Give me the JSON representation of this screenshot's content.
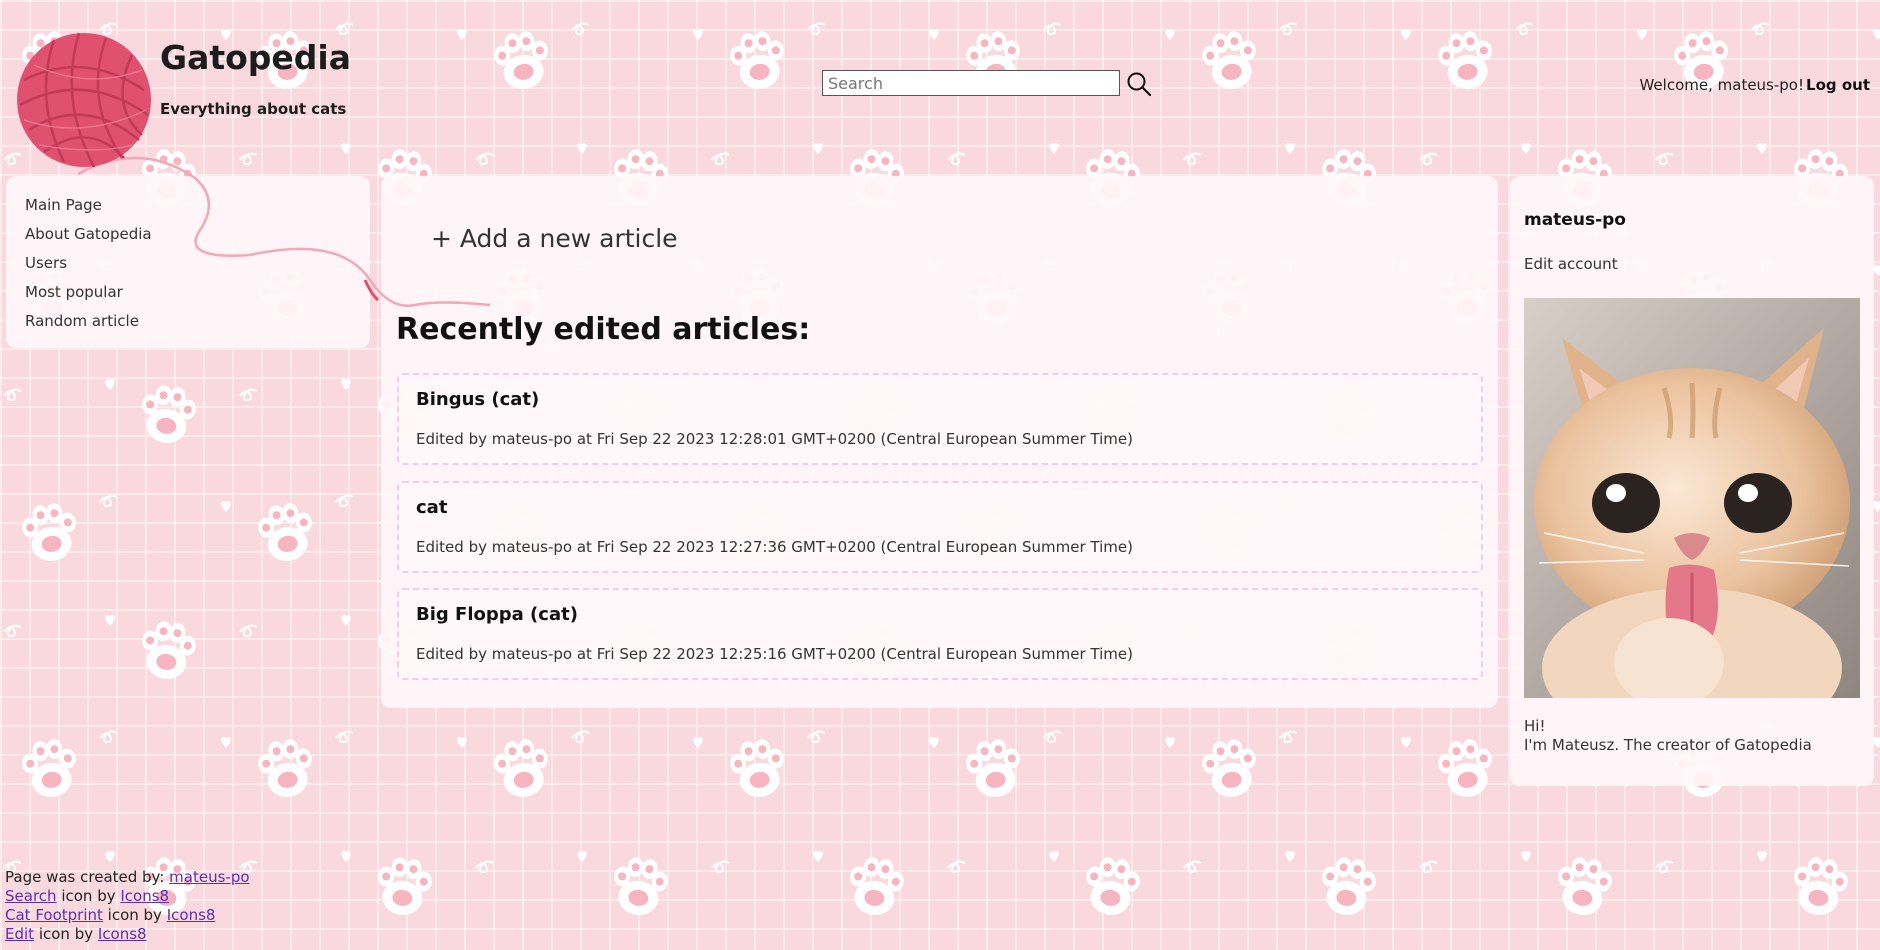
{
  "header": {
    "site_title": "Gatopedia",
    "tagline": "Everything about cats",
    "search_placeholder": "Search",
    "welcome": "Welcome, mateus-po!",
    "logout": "Log out"
  },
  "sidebar": {
    "items": [
      {
        "label": "Main Page"
      },
      {
        "label": "About Gatopedia"
      },
      {
        "label": "Users"
      },
      {
        "label": "Most popular"
      },
      {
        "label": "Random article"
      }
    ]
  },
  "main": {
    "add_article": "+ Add a new article",
    "recent_heading": "Recently edited articles:",
    "articles": [
      {
        "title": "Bingus (cat)",
        "meta": "Edited by mateus-po at Fri Sep 22 2023 12:28:01 GMT+0200 (Central European Summer Time)"
      },
      {
        "title": "cat",
        "meta": "Edited by mateus-po at Fri Sep 22 2023 12:27:36 GMT+0200 (Central European Summer Time)"
      },
      {
        "title": "Big Floppa (cat)",
        "meta": "Edited by mateus-po at Fri Sep 22 2023 12:25:16 GMT+0200 (Central European Summer Time)"
      }
    ]
  },
  "profile": {
    "name": "mateus-po",
    "edit_account": "Edit account",
    "bio_line1": "Hi!",
    "bio_line2": "I'm Mateusz. The creator of Gatopedia"
  },
  "footer": {
    "created_by_prefix": "Page was created by:",
    "created_by_link": "mateus-po",
    "line2_link": "Search",
    "line3_link": "Cat Footprint",
    "line4_link": "Edit",
    "icon_by": "icon by",
    "icons8": "Icons8"
  },
  "icons": {
    "logo": "yarn-ball-icon",
    "search": "search-icon",
    "background": "cat-footprint-icon"
  },
  "colors": {
    "background": "#f9d9de",
    "paw": "#ffffff",
    "paw_pad": "#f6b5c0",
    "yarn": "#e0506f",
    "link": "#5a2fb8",
    "card_border": "#f7cbe6"
  }
}
